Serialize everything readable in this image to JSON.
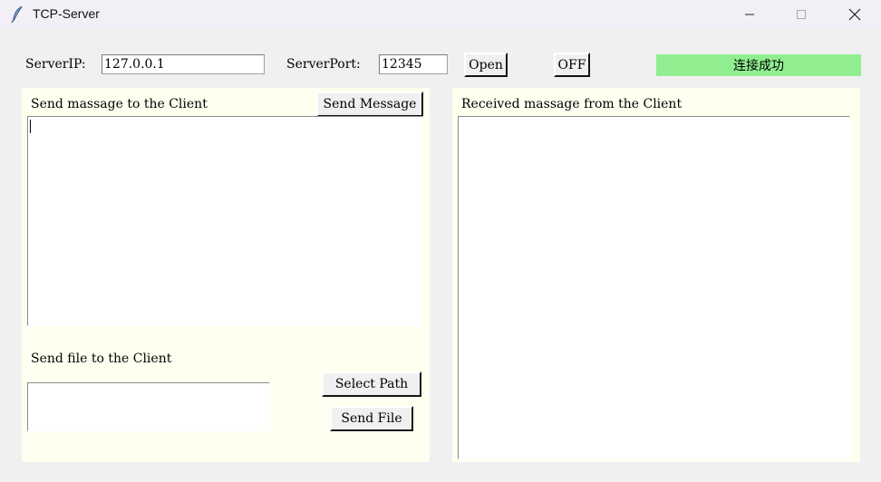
{
  "window": {
    "title": "TCP-Server",
    "icon": "feather-icon",
    "controls": {
      "minimize": "minimize-icon",
      "maximize": "maximize-icon",
      "close": "close-icon"
    }
  },
  "connection": {
    "ip_label": "ServerIP:",
    "ip_value": "127.0.0.1",
    "port_label": "ServerPort:",
    "port_value": "12345",
    "open_label": "Open",
    "off_label": "OFF",
    "status_text": "连接成功",
    "status_color": "#90ee90"
  },
  "send_panel": {
    "message_label": "Send massage to the Client",
    "send_message_label": "Send Message",
    "message_text": "",
    "file_label": "Send file to the Client",
    "path_value": "",
    "select_path_label": "Select Path",
    "send_file_label": "Send File"
  },
  "receive_panel": {
    "label": "Received massage from the Client",
    "content": ""
  },
  "colors": {
    "panel_bg": "#fffff0",
    "window_bg": "#f0f0f0"
  }
}
